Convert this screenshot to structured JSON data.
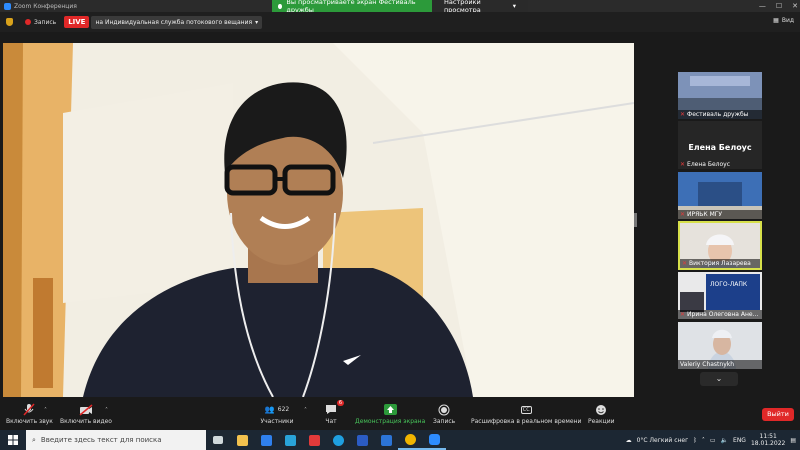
{
  "window": {
    "title": "Zoom Конференция",
    "controls": [
      "—",
      "☐",
      "✕"
    ]
  },
  "share_banner": {
    "message": "Вы просматриваете экран Фестиваль дружбы",
    "options": "Настройки просмотра"
  },
  "topbar": {
    "record_label": "Запись",
    "live": "LIVE",
    "stream_target": "на Индивидуальная служба потокового вещания",
    "view_label": "Вид"
  },
  "gallery": [
    {
      "name": "Фестиваль дружбы",
      "muted": true
    },
    {
      "name": "Елена Белоус",
      "big_name": "Елена Белоус",
      "muted": true
    },
    {
      "name": "ИРЯЬК МГУ",
      "muted": true
    },
    {
      "name": "Виктория Лазарева",
      "muted": true,
      "active_speaker": true
    },
    {
      "name": "Ирина Олеговна Ане...",
      "muted": true
    },
    {
      "name": "Valeriy Chastnykh",
      "muted": false
    }
  ],
  "toolbar": {
    "unmute": "Включить звук",
    "start_video": "Включить видео",
    "participants": "Участники",
    "participants_count": "622",
    "chat": "Чат",
    "chat_badge": "6",
    "share_screen": "Демонстрация экрана",
    "record": "Запись",
    "captions": "Расшифровка в реальном времени",
    "captions_icon_text": "CC",
    "reactions": "Реакции",
    "leave": "Выйти"
  },
  "taskbar": {
    "search_placeholder": "Введите здесь текст для поиска",
    "weather": "0°C  Легкий снег",
    "lang": "ENG",
    "time": "11:51",
    "date": "18.01.2022",
    "apps": [
      {
        "name": "task-view",
        "color": "#cfd8dc"
      },
      {
        "name": "file-explorer",
        "color": "#f2c14e"
      },
      {
        "name": "store",
        "color": "#2f80ed"
      },
      {
        "name": "app-l",
        "color": "#29a3d9"
      },
      {
        "name": "yandex",
        "color": "#e13a3a"
      },
      {
        "name": "edge",
        "color": "#1f9fe0"
      },
      {
        "name": "word",
        "color": "#2b5cc4"
      },
      {
        "name": "mail",
        "color": "#2c74d6"
      },
      {
        "name": "chrome",
        "color": "#f0b400"
      },
      {
        "name": "zoom",
        "color": "#2d8cff"
      }
    ]
  },
  "colors": {
    "live_red": "#e02828",
    "share_green": "#2c9a3a",
    "active_speaker": "#d7e04a",
    "zoom_blue": "#2d8cff"
  }
}
